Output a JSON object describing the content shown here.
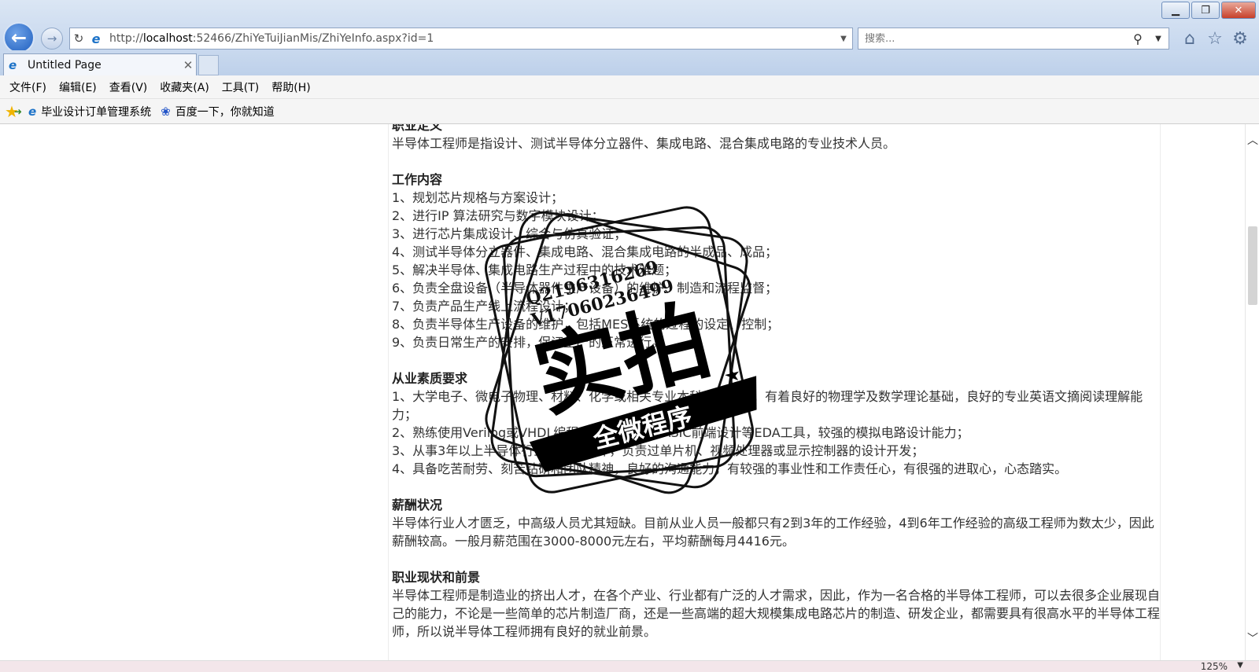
{
  "browser": {
    "address": {
      "protocol": "http://",
      "host": "localhost",
      "rest": ":52466/ZhiYeTuiJianMis/ZhiYeInfo.aspx?id=1"
    },
    "search_placeholder": "搜索...",
    "tab_title": "Untitled Page",
    "menu": [
      "文件(F)",
      "编辑(E)",
      "查看(V)",
      "收藏夹(A)",
      "工具(T)",
      "帮助(H)"
    ],
    "favorites": [
      "毕业设计订单管理系统",
      "百度一下，你就知道"
    ],
    "zoom": "125%"
  },
  "content": {
    "definition": {
      "title": "职业定义",
      "text": "半导体工程师是指设计、测试半导体分立器件、集成电路、混合集成电路的专业技术人员。"
    },
    "work": {
      "title": "工作内容",
      "items": [
        "1、规划芯片规格与方案设计；",
        "2、进行IP 算法研究与数字模块设计；",
        "3、进行芯片集成设计、综合与仿真验证；",
        "4、测试半导体分立器件、集成电路、混合集成电路的半成品、成品；",
        "5、解决半导体、集成电路生产过程中的技术难题；",
        "6、负责全盘设备（半导体器件生产设备）的维护、制造和流程监督；",
        "7、负责产品生产线上流程设计；",
        "8、负责半导体生产设备的维护，包括MES系统的过程的设定、控制；",
        "9、负责日常生产的安排，保证生产的正常进行。"
      ]
    },
    "quality": {
      "title": "从业素质要求",
      "items": [
        "1、大学电子、微电子物理、材料、化学或相关专业本科以上学历，有着良好的物理学及数学理论基础，良好的专业英语文摘阅读理解能力；",
        "2、熟练使用Verilog或VHDL编程，熟悉FPGA、ASIC前端设计等EDA工具，较强的模拟电路设计能力；",
        "3、从事3年以上半导体行业及相关工作，负责过单片机、视频处理器或显示控制器的设计开发；",
        "4、具备吃苦耐劳、刻苦钻研和团队精神，良好的沟通能力，有较强的事业性和工作责任心，有很强的进取心，心态踏实。"
      ]
    },
    "salary": {
      "title": "薪酬状况",
      "text": "半导体行业人才匮乏，中高级人员尤其短缺。目前从业人员一般都只有2到3年的工作经验，4到6年工作经验的高级工程师为数太少，因此薪酬较高。一般月薪范围在3000-8000元左右，平均薪酬每月4416元。"
    },
    "prospect": {
      "title": "职业现状和前景",
      "text": "半导体工程师是制造业的挤出人才，在各个产业、行业都有广泛的人才需求，因此，作为一名合格的半导体工程师，可以去很多企业展现自己的能力，不论是一些简单的芯片制造厂商，还是一些高端的超大规模集成电路芯片的制造、研发企业，都需要具有很高水平的半导体工程师，所以说半导体工程师拥有良好的就业前景。"
    }
  },
  "stamp": {
    "qq": "Q2196316269",
    "vx": "V17060236499",
    "main": "实拍",
    "banner": "全微程序"
  },
  "icons": {
    "back": "back-arrow-icon",
    "forward": "forward-arrow-icon",
    "refresh": "refresh-icon",
    "ie": "ie-logo-icon",
    "search": "magnifier-icon",
    "home": "home-icon",
    "favorites": "star-icon",
    "settings": "gear-icon"
  }
}
